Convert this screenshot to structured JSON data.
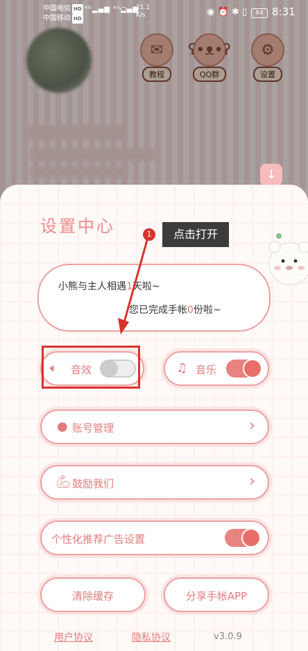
{
  "status_bar": {
    "carrier1": "中国电信",
    "carrier2": "中国移动",
    "hd_label": "HD",
    "net_speed": "21.1",
    "net_unit": "K/s",
    "battery": "84",
    "time": "8:31"
  },
  "header": {
    "buttons": [
      {
        "label": "教程",
        "icon": "envelope-icon"
      },
      {
        "label": "QQ群",
        "icon": "bear-icon"
      },
      {
        "label": "设置",
        "icon": "gear-icon"
      }
    ]
  },
  "panel": {
    "title": "设置中心",
    "bubble": {
      "line1_pre": "小熊与主人相遇",
      "line1_num": "1",
      "line1_post": "天啦~",
      "line2_pre": "您已完成手帐",
      "line2_num": "0",
      "line2_post": "份啦~"
    },
    "sound": {
      "label": "音效",
      "toggle": "off"
    },
    "music": {
      "label": "音乐",
      "toggle": "on"
    },
    "account": {
      "label": "账号管理"
    },
    "encourage": {
      "label": "鼓励我们"
    },
    "ads": {
      "label": "个性化推荐广告设置",
      "toggle": "on"
    },
    "clear_cache": {
      "label": "清除缓存"
    },
    "share": {
      "label": "分享手帐APP"
    },
    "footer": {
      "user_agreement": "用户协议",
      "privacy": "隐私协议",
      "version": "v3.0.9"
    }
  },
  "annotation": {
    "step": "1",
    "text": "点击打开"
  },
  "colors": {
    "accent": "#e27c7c",
    "border": "#eca0a0",
    "highlight_box": "#d8322f"
  }
}
